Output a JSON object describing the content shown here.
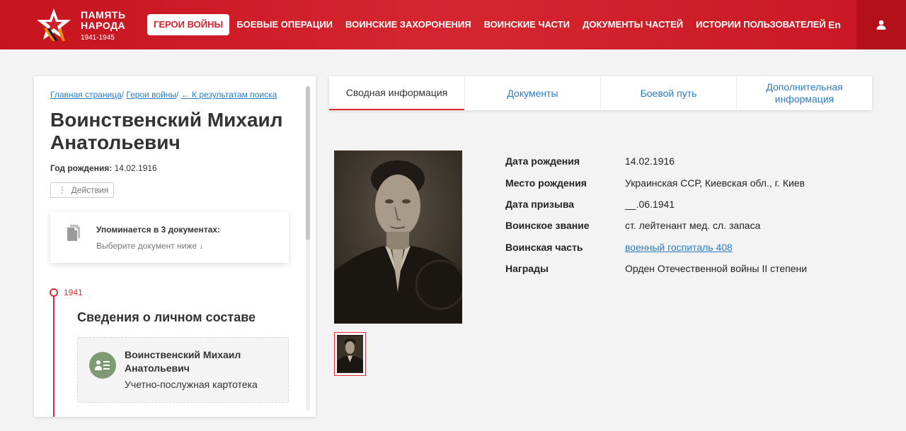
{
  "header": {
    "logo_line1": "ПАМЯТЬ",
    "logo_line2": "НАРОДА",
    "logo_years": "1941-1945",
    "nav": [
      {
        "label": "ГЕРОИ ВОЙНЫ",
        "active": true
      },
      {
        "label": "БОЕВЫЕ ОПЕРАЦИИ"
      },
      {
        "label": "ВОИНСКИЕ ЗАХОРОНЕНИЯ"
      },
      {
        "label": "ВОИНСКИЕ ЧАСТИ"
      },
      {
        "label": "ДОКУМЕНТЫ ЧАСТЕЙ"
      },
      {
        "label": "ИСТОРИИ ПОЛЬЗОВАТЕЛЕЙ"
      }
    ],
    "lang": "En",
    "user_icon": "user-icon",
    "brand_color": "#d3212d"
  },
  "breadcrumb": {
    "home": "Главная страница",
    "sep1": "/ ",
    "heroes": "Герои войны",
    "sep2": "/ ",
    "back": "← К результатам поиска"
  },
  "hero": {
    "name": "Воинственский Михаил Анатольевич",
    "birth_label": "Год рождения:",
    "birth_year": "14.02.1916",
    "actions_icon": "⋮",
    "actions_label": "Действия"
  },
  "documents_card": {
    "title": "Упоминается в 3 документах:",
    "subtitle": "Выберите документ ниже ↓"
  },
  "timeline": {
    "year": "1941",
    "section_title": "Сведения о личном составе",
    "record": {
      "name": "Воинственский Михаил Анатольевич",
      "type": "Учетно-послужная картотека"
    }
  },
  "tabs": [
    {
      "label": "Сводная информация",
      "active": true
    },
    {
      "label": "Документы"
    },
    {
      "label": "Боевой путь"
    },
    {
      "label": "Дополнительная информация"
    }
  ],
  "info": [
    {
      "label": "Дата рождения",
      "value": "14.02.1916"
    },
    {
      "label": "Место рождения",
      "value": "Украинская ССР, Киевская обл., г. Киев"
    },
    {
      "label": "Дата призыва",
      "value": "__.06.1941"
    },
    {
      "label": "Воинское звание",
      "value": "ст. лейтенант мед. сл. запаса"
    },
    {
      "label": "Воинская часть",
      "value": "военный госпиталь 408",
      "link": true
    },
    {
      "label": "Награды",
      "value": "Орден Отечественной войны II степени"
    }
  ]
}
